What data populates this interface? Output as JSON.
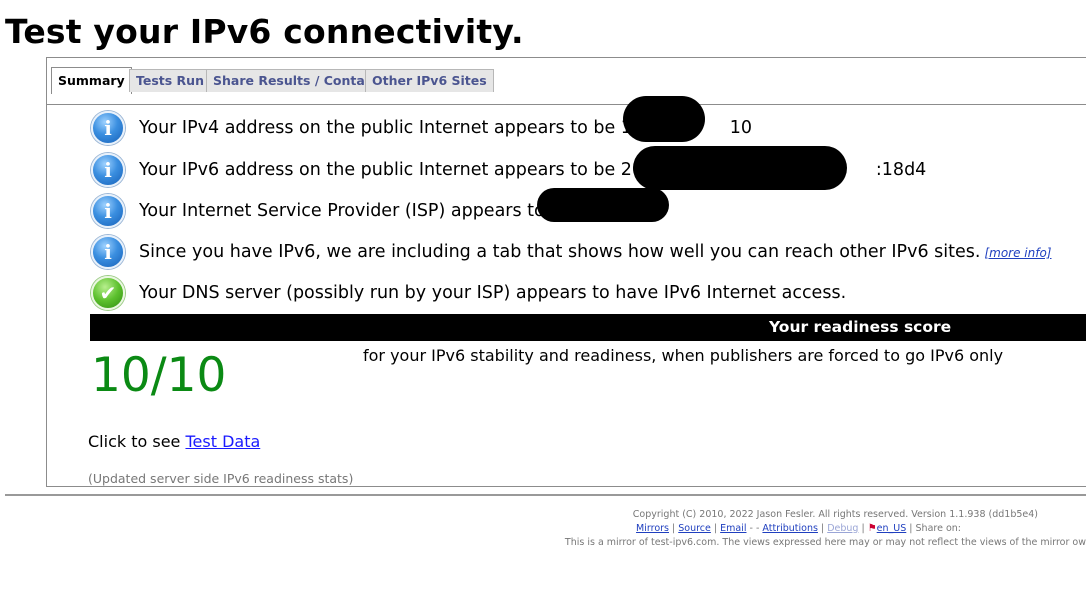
{
  "page": {
    "title": "Test your IPv6 connectivity."
  },
  "tabs": [
    {
      "label": "Summary",
      "active": true
    },
    {
      "label": "Tests Run"
    },
    {
      "label": "Share Results / Contact"
    },
    {
      "label": "Other IPv6 Sites"
    }
  ],
  "results": [
    {
      "icon": "info-icon",
      "text": "Your IPv4 address on the public Internet appears to be 170",
      "tail": "10"
    },
    {
      "icon": "info-icon",
      "text": "Your IPv6 address on the public Internet appears to be 2610",
      "tail": ":18d4"
    },
    {
      "icon": "info-icon",
      "text": "Your Internet Service Provider (ISP) appears to be"
    },
    {
      "icon": "info-icon",
      "text": "Since you have IPv6, we are including a tab that shows how well you can reach other IPv6 sites.",
      "link": "[more info]"
    },
    {
      "icon": "check-icon",
      "text": "Your DNS server (possibly run by your ISP) appears to have IPv6 Internet access."
    }
  ],
  "readiness": {
    "header": "Your readiness score",
    "score": "10/10",
    "description": "for your IPv6 stability and readiness, when publishers are forced to go IPv6 only"
  },
  "test_data": {
    "prefix": "Click to see ",
    "link": "Test Data"
  },
  "updated_note": "(Updated server side IPv6 readiness stats)",
  "footer": {
    "copyright": "Copyright (C) 2010, 2022 Jason Fesler. All rights reserved. Version 1.1.938 (dd1b5e4)",
    "links": [
      "Mirrors",
      "Source",
      "Email",
      "Attributions",
      "Debug"
    ],
    "locale": "en_US",
    "share": "Share on:",
    "mirror_note": "This is a mirror of test-ipv6.com. The views expressed here may or may not reflect the views of the mirror ow"
  },
  "colors": {
    "score_green": "#0b8a14",
    "link_blue": "#1a1aff",
    "tab_text": "#4b5590"
  }
}
